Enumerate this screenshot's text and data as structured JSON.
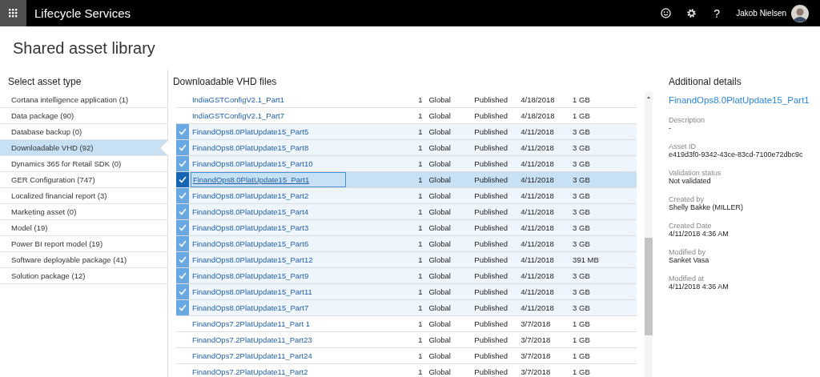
{
  "header": {
    "title": "Lifecycle Services",
    "help": "?",
    "user": "Jakob Nielsen"
  },
  "page_title": "Shared asset library",
  "asset_types": {
    "heading": "Select asset type",
    "items": [
      {
        "label": "Cortana intelligence application (1)",
        "selected": false
      },
      {
        "label": "Data package (90)",
        "selected": false
      },
      {
        "label": "Database backup (0)",
        "selected": false
      },
      {
        "label": "Downloadable VHD (92)",
        "selected": true
      },
      {
        "label": "Dynamics 365 for Retail SDK (0)",
        "selected": false
      },
      {
        "label": "GER Configuration (747)",
        "selected": false
      },
      {
        "label": "Localized financial report (3)",
        "selected": false
      },
      {
        "label": "Marketing asset (0)",
        "selected": false
      },
      {
        "label": "Model (19)",
        "selected": false
      },
      {
        "label": "Power BI report model (19)",
        "selected": false
      },
      {
        "label": "Software deployable package (41)",
        "selected": false
      },
      {
        "label": "Solution package (12)",
        "selected": false
      }
    ]
  },
  "files": {
    "heading": "Downloadable VHD files",
    "rows": [
      {
        "name": "IndiaGSTConfigV2.1_Part1",
        "count": "1",
        "scope": "Global",
        "status": "Published",
        "date": "4/18/2018",
        "size": "1 GB",
        "checked": false,
        "selected": false
      },
      {
        "name": "IndiaGSTConfigV2.1_Part7",
        "count": "1",
        "scope": "Global",
        "status": "Published",
        "date": "4/18/2018",
        "size": "1 GB",
        "checked": false,
        "selected": false
      },
      {
        "name": "FinandOps8.0PlatUpdate15_Part5",
        "count": "1",
        "scope": "Global",
        "status": "Published",
        "date": "4/11/2018",
        "size": "3 GB",
        "checked": true,
        "selected": false
      },
      {
        "name": "FinandOps8.0PlatUpdate15_Part8",
        "count": "1",
        "scope": "Global",
        "status": "Published",
        "date": "4/11/2018",
        "size": "3 GB",
        "checked": true,
        "selected": false
      },
      {
        "name": "FinandOps8.0PlatUpdate15_Part10",
        "count": "1",
        "scope": "Global",
        "status": "Published",
        "date": "4/11/2018",
        "size": "3 GB",
        "checked": true,
        "selected": false
      },
      {
        "name": "FinandOps8.0PlatUpdate15_Part1",
        "count": "1",
        "scope": "Global",
        "status": "Published",
        "date": "4/11/2018",
        "size": "3 GB",
        "checked": true,
        "selected": true
      },
      {
        "name": "FinandOps8.0PlatUpdate15_Part2",
        "count": "1",
        "scope": "Global",
        "status": "Published",
        "date": "4/11/2018",
        "size": "3 GB",
        "checked": true,
        "selected": false
      },
      {
        "name": "FinandOps8.0PlatUpdate15_Part4",
        "count": "1",
        "scope": "Global",
        "status": "Published",
        "date": "4/11/2018",
        "size": "3 GB",
        "checked": true,
        "selected": false
      },
      {
        "name": "FinandOps8.0PlatUpdate15_Part3",
        "count": "1",
        "scope": "Global",
        "status": "Published",
        "date": "4/11/2018",
        "size": "3 GB",
        "checked": true,
        "selected": false
      },
      {
        "name": "FinandOps8.0PlatUpdate15_Part6",
        "count": "1",
        "scope": "Global",
        "status": "Published",
        "date": "4/11/2018",
        "size": "3 GB",
        "checked": true,
        "selected": false
      },
      {
        "name": "FinandOps8.0PlatUpdate15_Part12",
        "count": "1",
        "scope": "Global",
        "status": "Published",
        "date": "4/11/2018",
        "size": "391 MB",
        "checked": true,
        "selected": false
      },
      {
        "name": "FinandOps8.0PlatUpdate15_Part9",
        "count": "1",
        "scope": "Global",
        "status": "Published",
        "date": "4/11/2018",
        "size": "3 GB",
        "checked": true,
        "selected": false
      },
      {
        "name": "FinandOps8.0PlatUpdate15_Part11",
        "count": "1",
        "scope": "Global",
        "status": "Published",
        "date": "4/11/2018",
        "size": "3 GB",
        "checked": true,
        "selected": false
      },
      {
        "name": "FinandOps8.0PlatUpdate15_Part7",
        "count": "1",
        "scope": "Global",
        "status": "Published",
        "date": "4/11/2018",
        "size": "3 GB",
        "checked": true,
        "selected": false
      },
      {
        "name": "FinandOps7.2PlatUpdate11_Part 1",
        "count": "1",
        "scope": "Global",
        "status": "Published",
        "date": "3/7/2018",
        "size": "1 GB",
        "checked": false,
        "selected": false
      },
      {
        "name": "FinandOps7.2PlatUpdate11_Part23",
        "count": "1",
        "scope": "Global",
        "status": "Published",
        "date": "3/7/2018",
        "size": "1 GB",
        "checked": false,
        "selected": false
      },
      {
        "name": "FinandOps7.2PlatUpdate11_Part24",
        "count": "1",
        "scope": "Global",
        "status": "Published",
        "date": "3/7/2018",
        "size": "1 GB",
        "checked": false,
        "selected": false
      },
      {
        "name": "FinandOps7.2PlatUpdate11_Part2",
        "count": "1",
        "scope": "Global",
        "status": "Published",
        "date": "3/7/2018",
        "size": "1 GB",
        "checked": false,
        "selected": false
      }
    ]
  },
  "details": {
    "heading": "Additional details",
    "title": "FinandOps8.0PlatUpdate15_Part1",
    "fields": [
      {
        "label": "Description",
        "value": "-"
      },
      {
        "label": "Asset ID",
        "value": "e419d3f0-9342-43ce-83cd-7100e72dbc9c"
      },
      {
        "label": "Validation status",
        "value": "Not validated"
      },
      {
        "label": "Created by",
        "value": "Shelly Bakke (MILLER)"
      },
      {
        "label": "Created Date",
        "value": "4/11/2018 4:36 AM"
      },
      {
        "label": "Modified by",
        "value": "Sanket Vasa"
      },
      {
        "label": "Modified at",
        "value": "4/11/2018 4:36 AM"
      }
    ]
  }
}
